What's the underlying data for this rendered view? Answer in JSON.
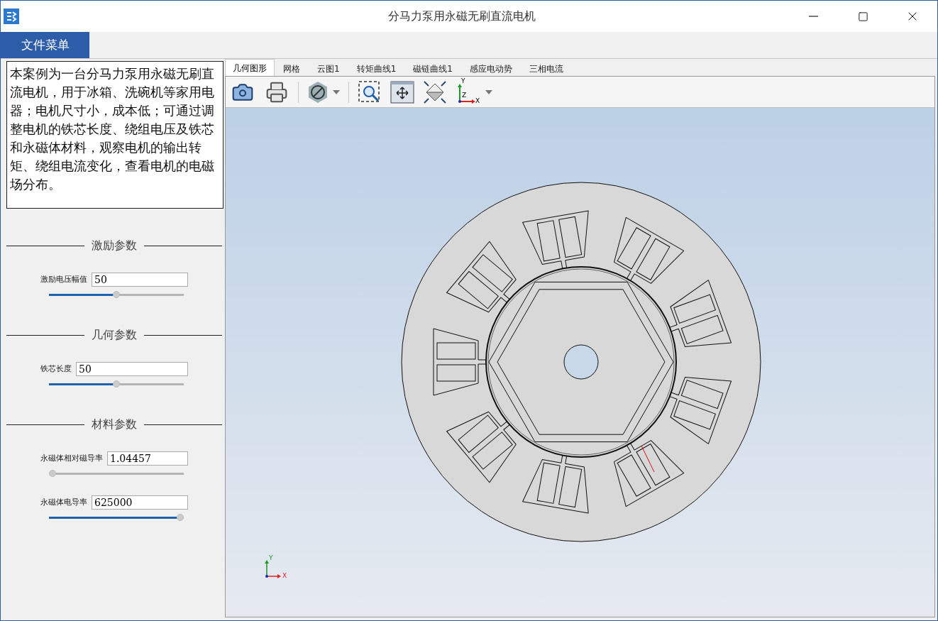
{
  "window": {
    "title": "分马力泵用永磁无刷直流电机"
  },
  "menu_button": "文件菜单",
  "description": "本案例为一台分马力泵用永磁无刷直流电机，用于冰箱、洗碗机等家用电器；电机尺寸小，成本低；可通过调整电机的铁芯长度、绕组电压及铁芯和永磁体材料，观察电机的输出转矩、绕组电流变化，查看电机的电磁场分布。",
  "parameter_groups": [
    {
      "title": "激励参数",
      "params": [
        {
          "label": "激励电压幅值",
          "value": "50",
          "level": 0.5
        }
      ]
    },
    {
      "title": "几何参数",
      "params": [
        {
          "label": "铁芯长度",
          "value": "50",
          "level": 0.5
        }
      ]
    },
    {
      "title": "材料参数",
      "params": [
        {
          "label": "永磁体相对磁导率",
          "value": "1.04457",
          "level": 0
        },
        {
          "label": "永磁体电导率",
          "value": "625000",
          "level": 1
        }
      ]
    }
  ],
  "tabs": [
    {
      "label": "几何图形",
      "selected": true
    },
    {
      "label": "网格",
      "selected": false
    },
    {
      "label": "云图1",
      "selected": false
    },
    {
      "label": "转矩曲线1",
      "selected": false
    },
    {
      "label": "磁链曲线1",
      "selected": false
    },
    {
      "label": "感应电动势",
      "selected": false
    },
    {
      "label": "三相电流",
      "selected": false
    }
  ],
  "toolbar": {
    "axes_labels": [
      "Y",
      "Z",
      "X"
    ]
  },
  "view_triad": {
    "y_label": "Y",
    "x_label": "X"
  }
}
